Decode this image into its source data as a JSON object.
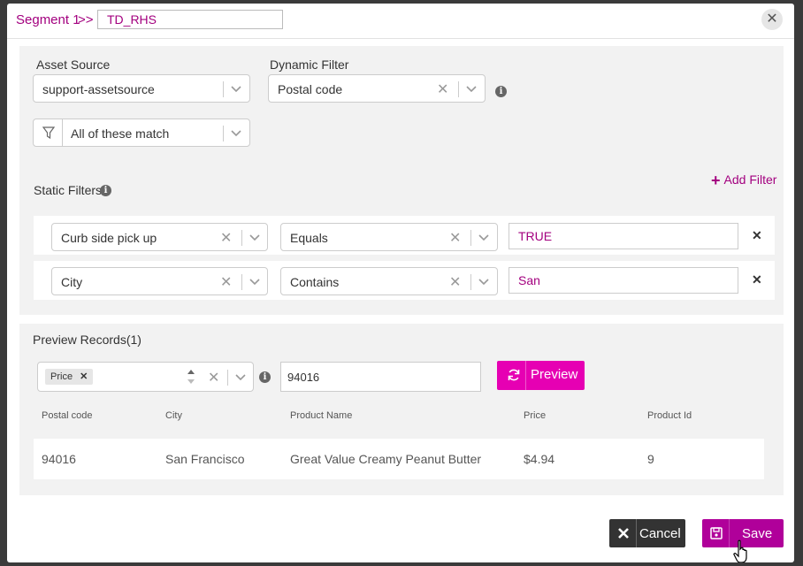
{
  "header": {
    "breadcrumb": "Segment 1",
    "separator": ">>",
    "segment_name": "TD_RHS",
    "close_icon": "close-icon"
  },
  "source": {
    "asset_source_label": "Asset Source",
    "asset_source_value": "support-assetsource",
    "dynamic_filter_label": "Dynamic Filter",
    "dynamic_filter_value": "Postal code",
    "match_value": "All of these match"
  },
  "static_filters": {
    "title": "Static Filters",
    "add_filter_label": "Add Filter",
    "rows": [
      {
        "field": "Curb side pick up",
        "operator": "Equals",
        "value": "TRUE"
      },
      {
        "field": "City",
        "operator": "Contains",
        "value": "San"
      }
    ]
  },
  "preview": {
    "title": "Preview Records(1)",
    "chip_label": "Price",
    "input_value": "94016",
    "button_label": "Preview",
    "columns": [
      "Postal code",
      "City",
      "Product Name",
      "Price",
      "Product Id"
    ],
    "rows": [
      [
        "94016",
        "San Francisco",
        "Great Value Creamy Peanut Butter",
        "$4.94",
        "9"
      ]
    ]
  },
  "footer": {
    "cancel_label": "Cancel",
    "save_label": "Save"
  },
  "colors": {
    "accent": "#a3007f",
    "preview_button": "#e600b3",
    "save_button": "#b0009a",
    "cancel_button": "#333333"
  }
}
